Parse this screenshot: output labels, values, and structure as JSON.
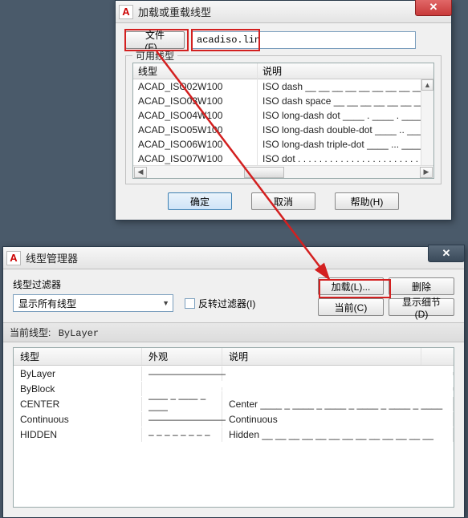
{
  "dialog1": {
    "title": "加载或重载线型",
    "fileButton": "文件(F)...",
    "fileValue": "acadiso.lin",
    "groupLabel": "可用线型",
    "headers": {
      "name": "线型",
      "desc": "说明"
    },
    "rows": [
      {
        "name": "ACAD_ISO02W100",
        "desc": "ISO dash __ __ __ __ __ __ __ __ __ __ __ __ __"
      },
      {
        "name": "ACAD_ISO03W100",
        "desc": "ISO dash space __   __   __   __   __   __   __"
      },
      {
        "name": "ACAD_ISO04W100",
        "desc": "ISO long-dash dot ____ . ____ . ____ . ____ ."
      },
      {
        "name": "ACAD_ISO05W100",
        "desc": "ISO long-dash double-dot ____ .. ____ .. ____"
      },
      {
        "name": "ACAD_ISO06W100",
        "desc": "ISO long-dash triple-dot ____ ... ____ ... ____"
      },
      {
        "name": "ACAD_ISO07W100",
        "desc": "ISO dot . . . . . . . . . . . . . . . . . . . . . . ."
      }
    ],
    "ok": "确定",
    "cancel": "取消",
    "help": "帮助(H)"
  },
  "dialog2": {
    "title": "线型管理器",
    "filterLabel": "线型过滤器",
    "filterValue": "显示所有线型",
    "invertFilter": "反转过滤器(I)",
    "loadBtn": "加载(L)...",
    "deleteBtn": "删除",
    "currentBtn": "当前(C)",
    "detailBtn": "显示细节(D)",
    "currentLineLabel": "当前线型:",
    "currentLineValue": "ByLayer",
    "headers": {
      "name": "线型",
      "appearance": "外观",
      "desc": "说明"
    },
    "rows": [
      {
        "name": "ByLayer",
        "appearance": "————————",
        "desc": ""
      },
      {
        "name": "ByBlock",
        "appearance": "",
        "desc": ""
      },
      {
        "name": "CENTER",
        "appearance": "—— – —— – ——",
        "desc": "Center ____ _ ____ _ ____ _ ____ _ ____ _ ____"
      },
      {
        "name": "Continuous",
        "appearance": "————————",
        "desc": "Continuous"
      },
      {
        "name": "HIDDEN",
        "appearance": "– – – – – – – –",
        "desc": "Hidden __ __ __ __ __ __ __ __ __ __ __ __ __"
      }
    ]
  }
}
